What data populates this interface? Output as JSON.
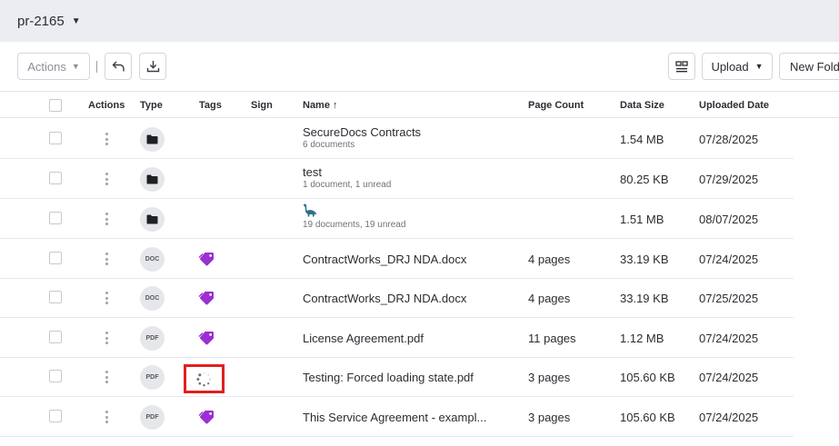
{
  "workspace": {
    "name": "pr-2165"
  },
  "toolbar": {
    "actions_label": "Actions",
    "upload_label": "Upload",
    "new_folder_label": "New Folde"
  },
  "table": {
    "columns": [
      "Actions",
      "Type",
      "Tags",
      "Sign",
      "Name",
      "Page Count",
      "Data Size",
      "Uploaded Date"
    ],
    "sort_indicator": "↑",
    "rows": [
      {
        "type": "folder",
        "name": "SecureDocs Contracts",
        "sub": "6 documents",
        "pages": "",
        "size": "1.54 MB",
        "date": "07/28/2025"
      },
      {
        "type": "folder",
        "name": "test",
        "sub": "1 document, 1 unread",
        "pages": "",
        "size": "80.25 KB",
        "date": "07/29/2025"
      },
      {
        "type": "folder",
        "name": "",
        "name_icon": "dinosaur-icon",
        "sub": "19 documents, 19 unread",
        "pages": "",
        "size": "1.51 MB",
        "date": "08/07/2025"
      },
      {
        "type": "DOC",
        "tag": "tag-icon",
        "name": "ContractWorks_DRJ NDA.docx",
        "pages": "4 pages",
        "size": "33.19 KB",
        "date": "07/24/2025"
      },
      {
        "type": "DOC",
        "tag": "tag-icon",
        "name": "ContractWorks_DRJ NDA.docx",
        "pages": "4 pages",
        "size": "33.19 KB",
        "date": "07/25/2025"
      },
      {
        "type": "PDF",
        "tag": "tag-icon",
        "name": "License Agreement.pdf",
        "pages": "11 pages",
        "size": "1.12 MB",
        "date": "07/24/2025"
      },
      {
        "type": "PDF",
        "tag": "loading-spinner-icon",
        "name": "Testing: Forced loading state.pdf",
        "pages": "3 pages",
        "size": "105.60 KB",
        "date": "07/24/2025"
      },
      {
        "type": "PDF",
        "tag": "tag-icon",
        "name": "This Service Agreement - exampl...",
        "pages": "3 pages",
        "size": "105.60 KB",
        "date": "07/24/2025"
      }
    ]
  },
  "colors": {
    "topbar_bg": "#ebedf2",
    "tag_purple": "#9b2fd1",
    "highlight_red": "#e0201d",
    "folder_icon": "#1f2024"
  }
}
